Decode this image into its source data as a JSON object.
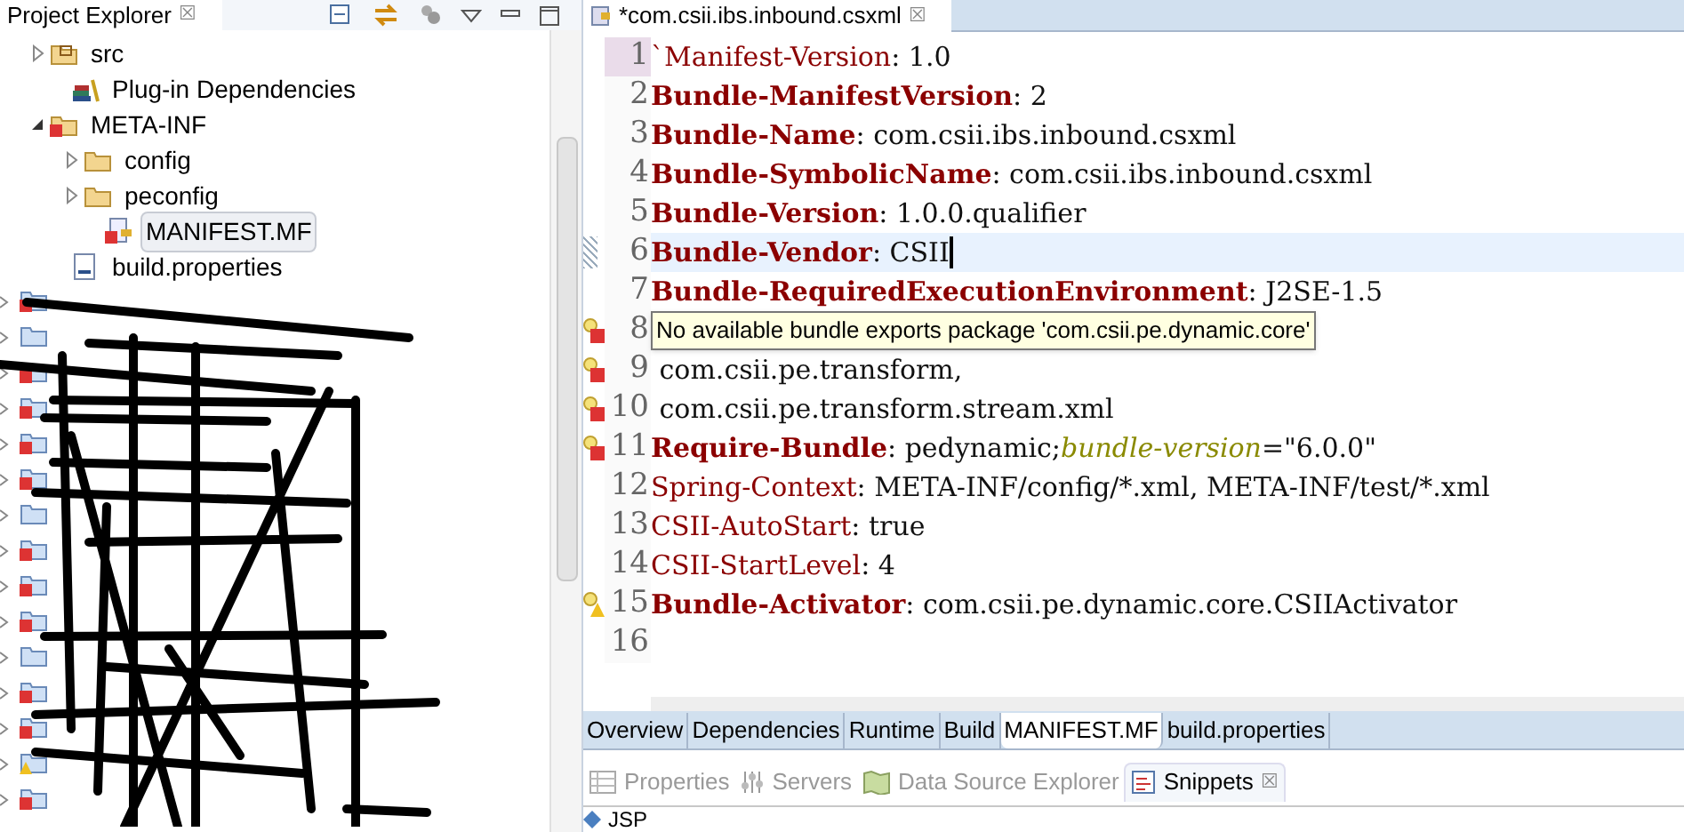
{
  "explorer": {
    "title": "Project Explorer",
    "close": "☒",
    "tree": [
      {
        "name": "src",
        "kind": "source",
        "expanded": false
      },
      {
        "name": "Plug-in Dependencies",
        "kind": "library"
      },
      {
        "name": "META-INF",
        "kind": "error-folder",
        "expanded": true,
        "children": [
          {
            "name": "config",
            "kind": "folder",
            "expanded": false
          },
          {
            "name": "peconfig",
            "kind": "folder",
            "expanded": false
          },
          {
            "name": "MANIFEST.MF",
            "kind": "manifest",
            "selected": true
          }
        ]
      },
      {
        "name": "build.properties",
        "kind": "file",
        "selected": false
      }
    ],
    "projects": [
      {
        "kind": "error"
      },
      {
        "kind": "ok"
      },
      {
        "kind": "error"
      },
      {
        "kind": "error"
      },
      {
        "kind": "error"
      },
      {
        "kind": "error"
      },
      {
        "kind": "ok"
      },
      {
        "kind": "error"
      },
      {
        "kind": "error"
      },
      {
        "kind": "error"
      },
      {
        "kind": "ok"
      },
      {
        "kind": "error"
      },
      {
        "kind": "error"
      },
      {
        "kind": "warning"
      },
      {
        "kind": "error"
      }
    ]
  },
  "editor": {
    "tab": {
      "title": "*com.csii.ibs.inbound.csxml",
      "close": "☒"
    },
    "lines": [
      {
        "no": "1",
        "key": "`Manifest-Version",
        "bold": false,
        "value": ": 1.0"
      },
      {
        "no": "2",
        "key": "Bundle-ManifestVersion",
        "bold": true,
        "value": ": 2"
      },
      {
        "no": "3",
        "key": "Bundle-Name",
        "bold": true,
        "value": ": com.csii.ibs.inbound.csxml"
      },
      {
        "no": "4",
        "key": "Bundle-SymbolicName",
        "bold": true,
        "value": ": com.csii.ibs.inbound.csxml"
      },
      {
        "no": "5",
        "key": "Bundle-Version",
        "bold": true,
        "value": ": 1.0.0.qualifier"
      },
      {
        "no": "6",
        "key": "Bundle-Vendor",
        "bold": true,
        "value": ": CSII",
        "current": true
      },
      {
        "no": "7",
        "key": "Bundle-RequiredExecutionEnvironment",
        "bold": true,
        "value": ": J2SE-1.5"
      },
      {
        "no": "8",
        "kind": "error"
      },
      {
        "no": "9",
        "value": " com.csii.pe.transform,",
        "kind": "error"
      },
      {
        "no": "10",
        "value": " com.csii.pe.transform.stream.xml",
        "kind": "error"
      },
      {
        "no": "11",
        "key": "Require-Bundle",
        "bold": true,
        "value": ": pedynamic;",
        "attr": "bundle-version",
        "rest": "=\"6.0.0\"",
        "kind": "error"
      },
      {
        "no": "12",
        "key": "Spring-Context",
        "bold": false,
        "value": ": META-INF/config/*.xml, META-INF/test/*.xml"
      },
      {
        "no": "13",
        "key": "CSII-AutoStart",
        "bold": false,
        "value": ": true"
      },
      {
        "no": "14",
        "key": "CSII-StartLevel",
        "bold": false,
        "value": ": 4"
      },
      {
        "no": "15",
        "key": "Bundle-Activator",
        "bold": true,
        "value": ": com.csii.pe.dynamic.core.CSIIActivator",
        "kind": "warning"
      },
      {
        "no": "16"
      }
    ],
    "tooltip": "No available bundle exports package 'com.csii.pe.dynamic.core'",
    "pages": [
      {
        "label": "Overview",
        "selected": false
      },
      {
        "label": "Dependencies",
        "selected": false
      },
      {
        "label": "Runtime",
        "selected": false
      },
      {
        "label": "Build",
        "selected": false
      },
      {
        "label": "MANIFEST.MF",
        "selected": true
      },
      {
        "label": "build.properties",
        "selected": false
      }
    ]
  },
  "views": {
    "tabs": [
      {
        "label": "Properties",
        "kind": "properties",
        "selected": false
      },
      {
        "label": "Servers",
        "kind": "servers",
        "selected": false
      },
      {
        "label": "Data Source Explorer",
        "kind": "datasource",
        "selected": false
      },
      {
        "label": "Snippets",
        "kind": "snippets",
        "selected": true,
        "close": "☒"
      }
    ],
    "row": "JSP"
  }
}
